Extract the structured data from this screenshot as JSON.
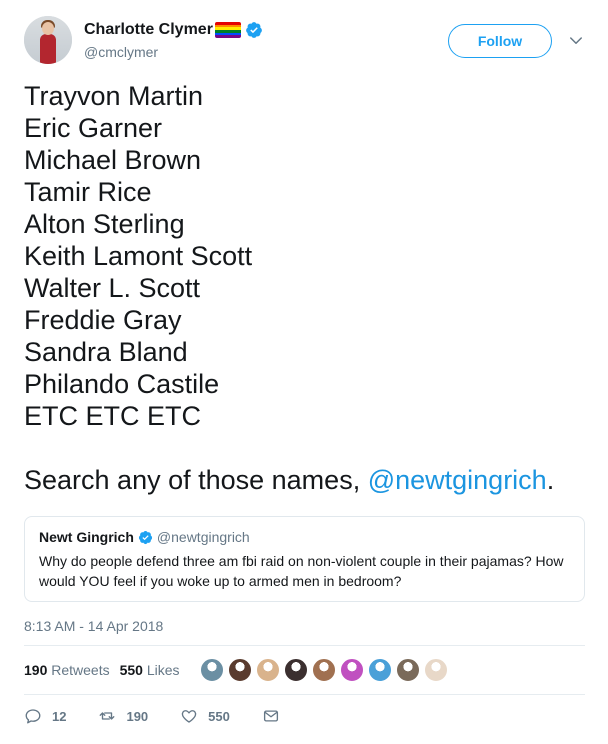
{
  "author": {
    "display_name": "Charlotte Clymer",
    "handle": "@cmclymer",
    "flag_colors": [
      "#e40303",
      "#ff8c00",
      "#ffed00",
      "#008026",
      "#004dff",
      "#750787"
    ]
  },
  "follow_label": "Follow",
  "tweet": {
    "names": [
      "Trayvon Martin",
      "Eric Garner",
      "Michael Brown",
      "Tamir Rice",
      "Alton Sterling",
      "Keith Lamont Scott",
      "Walter L. Scott",
      "Freddie Gray",
      "Sandra Bland",
      "Philando Castile",
      "ETC ETC ETC"
    ],
    "closing_prefix": "Search any of those names, ",
    "closing_mention": "@newtgingrich",
    "closing_suffix": "."
  },
  "quoted": {
    "display_name": "Newt Gingrich",
    "handle": "@newtgingrich",
    "text": "Why do people defend three am fbi raid on non-violent couple in their pajamas? How would YOU feel if you woke up to armed men in bedroom?"
  },
  "timestamp": "8:13 AM - 14 Apr 2018",
  "stats": {
    "retweets_count": "190",
    "retweets_label": "Retweets",
    "likes_count": "550",
    "likes_label": "Likes"
  },
  "likers": [
    "#6b8fa3",
    "#5a3b2e",
    "#d9b38c",
    "#3b2f2f",
    "#a07050",
    "#c050c0",
    "#4aa0d8",
    "#7a6a5a",
    "#e8d8c8"
  ],
  "actions": {
    "reply_count": "12",
    "retweet_count": "190",
    "like_count": "550"
  },
  "colors": {
    "accent": "#1da1f2",
    "mention": "#1b95e0",
    "secondary_text": "#657786",
    "verified": "#1da1f2"
  }
}
